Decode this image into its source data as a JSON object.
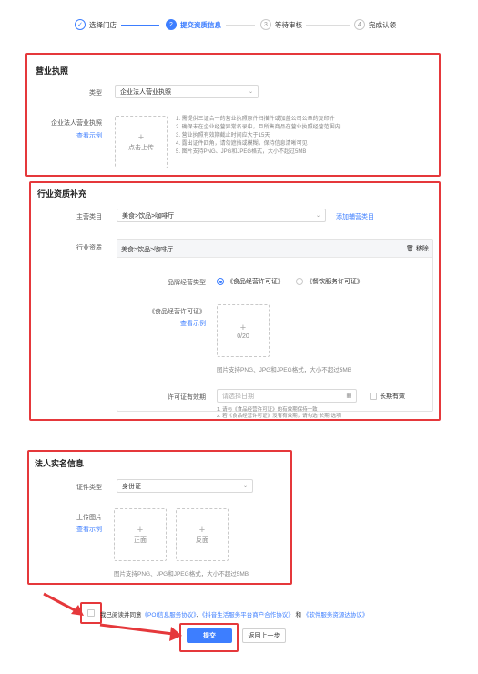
{
  "stepper": {
    "steps": [
      {
        "num": "✓",
        "label": "选择门店"
      },
      {
        "num": "2",
        "label": "提交资质信息"
      },
      {
        "num": "3",
        "label": "等待审核"
      },
      {
        "num": "4",
        "label": "完成认领"
      }
    ]
  },
  "business_license": {
    "title": "营业执照",
    "type_label": "类型",
    "type_value": "企业法人营业执照",
    "upload_label": "企业法人营业执照",
    "view_example": "查看示例",
    "upload_text": "点击上传",
    "tips": [
      "1. 需提供三证合一的营业执照原件扫描件或加盖公司公章的复印件",
      "2. 确保未在企业经营异常名录中，且所售商品在营业执照经营范围内",
      "3. 营业执照有效期截止时间应大于15天",
      "4. 露出证件四角，请勿遮挡或模糊，保持信息清晰可见",
      "5. 图片支持PNG、JPG和JPEG格式，大小不超过5MB"
    ]
  },
  "industry": {
    "title": "行业资质补充",
    "category_label": "主营类目",
    "category_value": "美食>饮品>咖啡厅",
    "add_category": "添加辅营类目",
    "qualification_label": "行业资质",
    "panel_title": "美食>饮品>咖啡厅",
    "remove": "移除",
    "permit_type_label": "品牌经营类型",
    "permit_options": [
      "《食品经营许可证》",
      "《餐饮服务许可证》"
    ],
    "permit_name": "《食品经营许可证》",
    "view_example": "查看示例",
    "upload_count": "0/20",
    "upload_tip": "图片支持PNG、JPG和JPEG格式，大小不超过5MB",
    "validity_label": "许可证有效期",
    "date_placeholder": "请选择日期",
    "long_term": "长期有效",
    "notes": [
      "1. 请与《食品经营许可证》的有效期保持一致",
      "2. 若《食品经营许可证》没有有效期，请勾选\"长期\"选项"
    ]
  },
  "legal_person": {
    "title": "法人实名信息",
    "id_type_label": "证件类型",
    "id_type_value": "身份证",
    "upload_label": "上传图片",
    "view_example": "查看示例",
    "front": "正面",
    "back": "反面",
    "tip": "图片支持PNG、JPG和JPEG格式，大小不超过5MB"
  },
  "agreement": {
    "prefix": "我已阅读并同意",
    "links": [
      "《POI信息服务协议》",
      "《抖音生活服务平台商户合作协议》"
    ],
    "and": "和",
    "last_link": "《软件服务资源达协议》"
  },
  "actions": {
    "submit": "提交",
    "back": "返回上一步"
  },
  "colors": {
    "accent": "#3d7eff",
    "highlight": "#e5383b"
  }
}
